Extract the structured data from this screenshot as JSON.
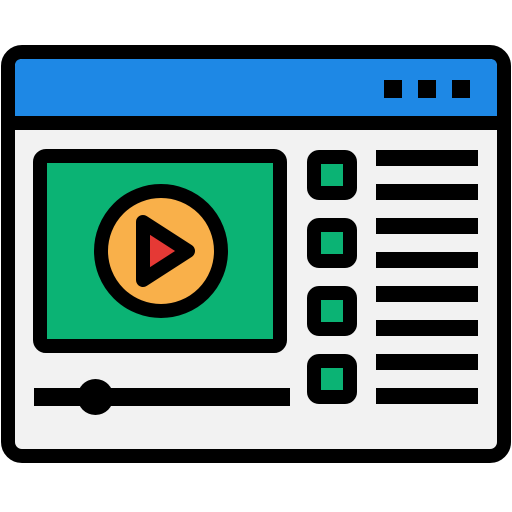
{
  "icon": {
    "name": "video-player-window-icon",
    "colors": {
      "outline": "#000000",
      "title_bar": "#1E88E5",
      "window_body": "#F2F2F2",
      "video_screen": "#0BB374",
      "play_circle": "#F9B04A",
      "play_triangle": "#E53935",
      "playlist_thumb": "#0BB374"
    },
    "window_controls": [
      "dot",
      "dot",
      "dot"
    ],
    "playlist": {
      "item_count": 4,
      "lines_per_item": 2
    },
    "progress": {
      "value": 0.24
    }
  }
}
